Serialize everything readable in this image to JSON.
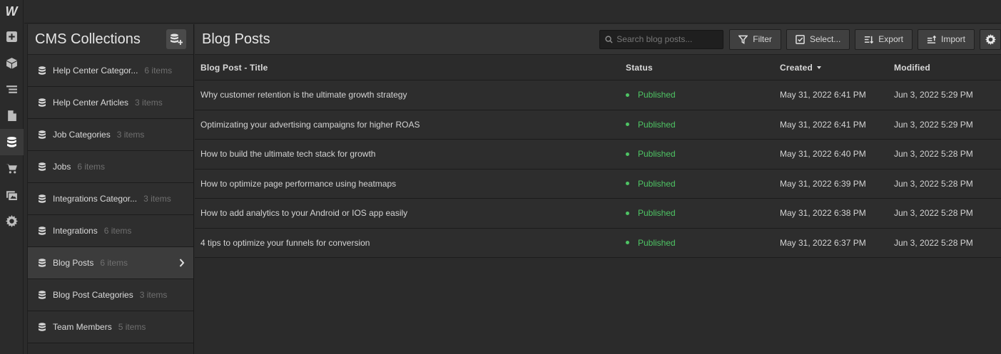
{
  "rail": {
    "logo": "W",
    "items": [
      "add-icon",
      "box-icon",
      "navigator-icon",
      "pages-icon",
      "cms-icon",
      "ecommerce-icon",
      "assets-icon",
      "settings-icon"
    ],
    "active": "cms-icon"
  },
  "collections": {
    "title": "CMS Collections",
    "items": [
      {
        "name": "Help Center Categor...",
        "count": "6 items"
      },
      {
        "name": "Help Center Articles",
        "count": "3 items"
      },
      {
        "name": "Job Categories",
        "count": "3 items"
      },
      {
        "name": "Jobs",
        "count": "6 items"
      },
      {
        "name": "Integrations Categor...",
        "count": "3 items"
      },
      {
        "name": "Integrations",
        "count": "6 items"
      },
      {
        "name": "Blog Posts",
        "count": "6 items"
      },
      {
        "name": "Blog Post Categories",
        "count": "3 items"
      },
      {
        "name": "Team Members",
        "count": "5 items"
      }
    ],
    "active_index": 6
  },
  "main": {
    "title": "Blog Posts",
    "search_placeholder": "Search blog posts...",
    "search_value": "",
    "buttons": {
      "filter": "Filter",
      "select": "Select...",
      "export": "Export",
      "import": "Import"
    },
    "columns": {
      "title": "Blog Post - Title",
      "status": "Status",
      "created": "Created",
      "modified": "Modified"
    },
    "rows": [
      {
        "title": "Why customer retention is the ultimate growth strategy",
        "status": "Published",
        "created": "May 31, 2022 6:41 PM",
        "modified": "Jun 3, 2022 5:29 PM"
      },
      {
        "title": "Optimizating your advertising campaigns for higher ROAS",
        "status": "Published",
        "created": "May 31, 2022 6:41 PM",
        "modified": "Jun 3, 2022 5:29 PM"
      },
      {
        "title": "How to build the ultimate tech stack for growth",
        "status": "Published",
        "created": "May 31, 2022 6:40 PM",
        "modified": "Jun 3, 2022 5:28 PM"
      },
      {
        "title": "How to optimize page performance using heatmaps",
        "status": "Published",
        "created": "May 31, 2022 6:39 PM",
        "modified": "Jun 3, 2022 5:28 PM"
      },
      {
        "title": "How to add analytics to your Android or IOS app easily",
        "status": "Published",
        "created": "May 31, 2022 6:38 PM",
        "modified": "Jun 3, 2022 5:28 PM"
      },
      {
        "title": "4 tips to optimize your funnels for conversion",
        "status": "Published",
        "created": "May 31, 2022 6:37 PM",
        "modified": "Jun 3, 2022 5:28 PM"
      }
    ]
  },
  "colors": {
    "published": "#4ec464",
    "background": "#2b2b2b",
    "panel_header": "#333333",
    "active_item": "#3c3c3c"
  }
}
